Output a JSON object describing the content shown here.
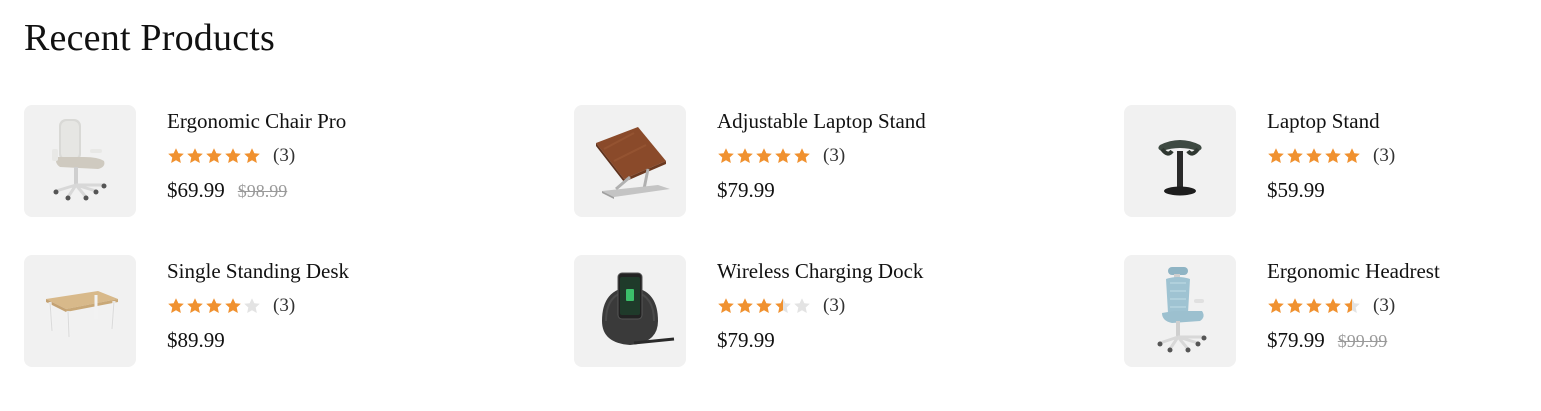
{
  "section": {
    "title": "Recent Products"
  },
  "colors": {
    "star": "#F0912F",
    "star_empty": "#E3E3E3",
    "thumb_bg": "#F1F1F1",
    "old_price": "#9A9A9A"
  },
  "products": [
    {
      "name": "Ergonomic Chair Pro",
      "rating": 5,
      "reviews": "(3)",
      "price": "$69.99",
      "old_price": "$98.99",
      "image_icon": "office-chair-icon"
    },
    {
      "name": "Adjustable Laptop Stand",
      "rating": 5,
      "reviews": "(3)",
      "price": "$79.99",
      "old_price": "",
      "image_icon": "laptop-stand-icon"
    },
    {
      "name": "Laptop Stand",
      "rating": 5,
      "reviews": "(3)",
      "price": "$59.99",
      "old_price": "",
      "image_icon": "saddle-stool-icon"
    },
    {
      "name": "Single Standing Desk",
      "rating": 4,
      "reviews": "(3)",
      "price": "$89.99",
      "old_price": "",
      "image_icon": "desk-icon"
    },
    {
      "name": "Wireless Charging Dock",
      "rating": 3.5,
      "reviews": "(3)",
      "price": "$79.99",
      "old_price": "",
      "image_icon": "charging-dock-icon"
    },
    {
      "name": "Ergonomic Headrest",
      "rating": 4.5,
      "reviews": "(3)",
      "price": "$79.99",
      "old_price": "$99.99",
      "image_icon": "headrest-chair-icon"
    }
  ]
}
